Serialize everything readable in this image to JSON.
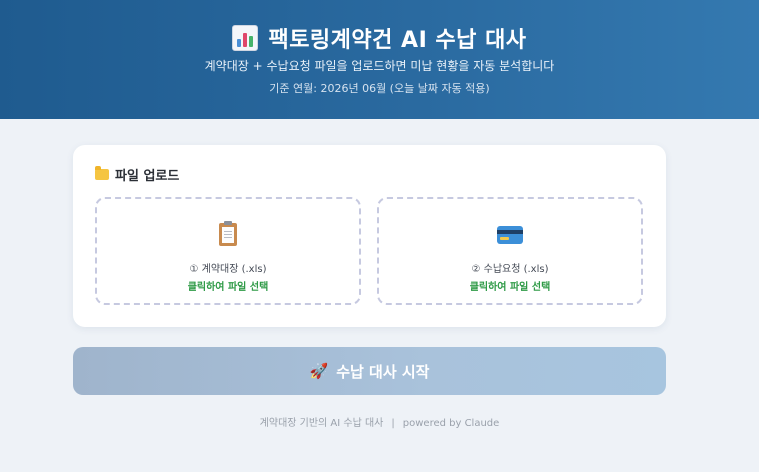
{
  "header": {
    "title": "팩토링계약건 AI 수납 대사",
    "subtitle": "계약대장 + 수납요청 파일을 업로드하면 미납 현황을 자동 분석합니다",
    "basis": "기준 연월: 2026년 06월 (오늘 날짜 자동 적용)"
  },
  "upload": {
    "title": "파일 업로드",
    "zones": [
      {
        "label": "① 계약대장 (.xls)",
        "action": "클릭하여 파일 선택",
        "icon": "clipboard-icon"
      },
      {
        "label": "② 수납요청 (.xls)",
        "action": "클릭하여 파일 선택",
        "icon": "credit-card-icon"
      }
    ]
  },
  "start_button": {
    "label": "수납 대사 시작",
    "icon": "rocket-icon"
  },
  "footer": {
    "left": "계약대장 기반의 AI 수납 대사",
    "separator": "|",
    "right": "powered by Claude"
  },
  "colors": {
    "header_start": "#1f5b8f",
    "header_end": "#3479b0",
    "action_green": "#2e9a46",
    "button_disabled": "#a9c2db"
  }
}
